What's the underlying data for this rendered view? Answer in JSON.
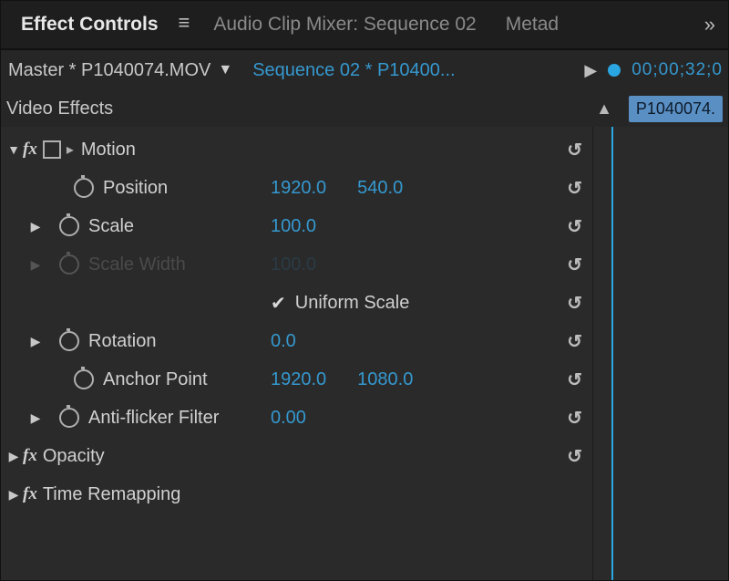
{
  "tabs": {
    "effect_controls": "Effect Controls",
    "audio_mixer": "Audio Clip Mixer: Sequence 02",
    "metadata": "Metad"
  },
  "master": {
    "clip": "Master * P1040074.MOV",
    "sequence": "Sequence 02 * P10400...",
    "timecode": "00;00;32;0"
  },
  "section": {
    "title": "Video Effects",
    "clip_chip": "P1040074."
  },
  "motion": {
    "title": "Motion",
    "position": {
      "label": "Position",
      "x": "1920.0",
      "y": "540.0"
    },
    "scale": {
      "label": "Scale",
      "value": "100.0"
    },
    "scale_width": {
      "label": "Scale Width",
      "value": "100.0"
    },
    "uniform": {
      "label": "Uniform Scale",
      "checked": true
    },
    "rotation": {
      "label": "Rotation",
      "value": "0.0"
    },
    "anchor": {
      "label": "Anchor Point",
      "x": "1920.0",
      "y": "1080.0"
    },
    "antiflicker": {
      "label": "Anti-flicker Filter",
      "value": "0.00"
    }
  },
  "opacity": {
    "title": "Opacity"
  },
  "time_remap": {
    "title": "Time Remapping"
  }
}
